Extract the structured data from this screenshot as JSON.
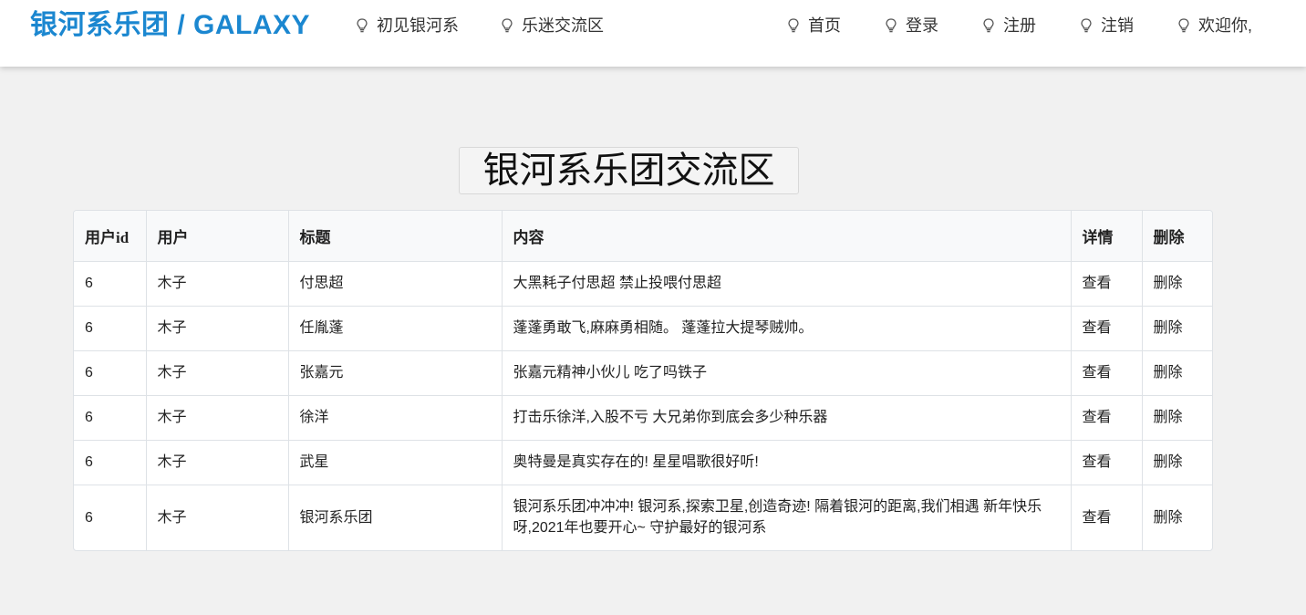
{
  "header": {
    "brand": "银河系乐团 / GALAXY",
    "brand_color": "#1b87d0",
    "nav_left": [
      {
        "label": "初见银河系",
        "icon": "lightbulb-icon"
      },
      {
        "label": "乐迷交流区",
        "icon": "lightbulb-icon"
      }
    ],
    "nav_right": [
      {
        "label": "首页",
        "icon": "lightbulb-icon"
      },
      {
        "label": "登录",
        "icon": "lightbulb-icon"
      },
      {
        "label": "注册",
        "icon": "lightbulb-icon"
      },
      {
        "label": "注销",
        "icon": "lightbulb-icon"
      },
      {
        "label": "欢迎你,",
        "icon": "lightbulb-icon"
      }
    ]
  },
  "main": {
    "title": "银河系乐团交流区",
    "table": {
      "columns": [
        "用户id",
        "用户",
        "标题",
        "内容",
        "详情",
        "删除"
      ],
      "rows": [
        {
          "id": "6",
          "user": "木子",
          "title": "付思超",
          "content": "大黑耗子付思超 禁止投喂付思超",
          "detail": "查看",
          "delete": "删除"
        },
        {
          "id": "6",
          "user": "木子",
          "title": "任胤蓬",
          "content": "蓬蓬勇敢飞,麻麻勇相随。 蓬蓬拉大提琴贼帅。",
          "detail": "查看",
          "delete": "删除"
        },
        {
          "id": "6",
          "user": "木子",
          "title": "张嘉元",
          "content": "张嘉元精神小伙儿 吃了吗铁子",
          "detail": "查看",
          "delete": "删除"
        },
        {
          "id": "6",
          "user": "木子",
          "title": "徐洋",
          "content": "打击乐徐洋,入股不亏 大兄弟你到底会多少种乐器",
          "detail": "查看",
          "delete": "删除"
        },
        {
          "id": "6",
          "user": "木子",
          "title": "武星",
          "content": "奥特曼是真实存在的! 星星唱歌很好听!",
          "detail": "查看",
          "delete": "删除"
        },
        {
          "id": "6",
          "user": "木子",
          "title": "银河系乐团",
          "content": "银河系乐团冲冲冲! 银河系,探索卫星,创造奇迹! 隔着银河的距离,我们相遇 新年快乐呀,2021年也要开心~ 守护最好的银河系",
          "detail": "查看",
          "delete": "删除"
        }
      ]
    }
  }
}
